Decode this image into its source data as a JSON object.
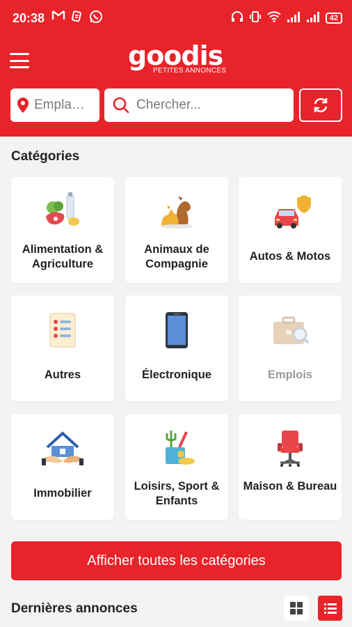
{
  "status_bar": {
    "time": "20:38",
    "battery": "42",
    "left_icons": [
      "gmail-icon",
      "app-icon",
      "whatsapp-icon"
    ],
    "right_icons": [
      "headphones-icon",
      "vibrate-icon",
      "wifi-icon",
      "signal-icon",
      "signal-icon",
      "battery-icon"
    ]
  },
  "header": {
    "logo_word": "goodis",
    "logo_subtitle": "PETITES ANNONCES",
    "location_placeholder": "Empla…",
    "search_placeholder": "Chercher...",
    "brand_color": "#e8232a"
  },
  "categories": {
    "title": "Catégories",
    "items": [
      {
        "label": "Alimentation & Agriculture",
        "icon": "groceries-icon",
        "enabled": true
      },
      {
        "label": "Animaux de Compagnie",
        "icon": "pets-icon",
        "enabled": true
      },
      {
        "label": "Autos & Motos",
        "icon": "car-icon",
        "enabled": true
      },
      {
        "label": "Autres",
        "icon": "list-icon",
        "enabled": true
      },
      {
        "label": "Électronique",
        "icon": "smartphone-icon",
        "enabled": true
      },
      {
        "label": "Emplois",
        "icon": "briefcase-icon",
        "enabled": false
      },
      {
        "label": "Immobilier",
        "icon": "house-handshake-icon",
        "enabled": true
      },
      {
        "label": "Loisirs, Sport & Enfants",
        "icon": "leisure-icon",
        "enabled": true
      },
      {
        "label": "Maison & Bureau",
        "icon": "office-chair-icon",
        "enabled": true
      }
    ]
  },
  "show_all_button": "Afficher toutes les catégories",
  "latest": {
    "title": "Dernières annonces",
    "view_mode": "list"
  }
}
